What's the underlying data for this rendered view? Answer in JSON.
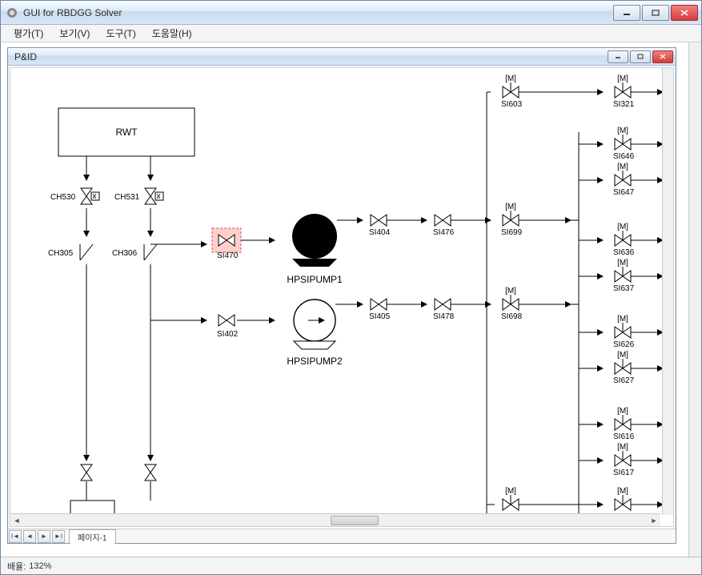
{
  "window": {
    "title": "GUI for RBDGG Solver"
  },
  "menu": {
    "evaluate": "평가(T)",
    "view": "보기(V)",
    "tools": "도구(T)",
    "help": "도움말(H)"
  },
  "inner": {
    "title": "P&ID"
  },
  "nav": {
    "page_tab": "페이지-1"
  },
  "status": {
    "zoom_label": "배율:",
    "zoom_value": "132%"
  },
  "diagram": {
    "blocks": {
      "rwt": "RWT",
      "pump1": "HPSIPUMP1",
      "pump2": "HPSIPUMP2"
    },
    "valves": {
      "ch530": "CH530",
      "ch531": "CH531",
      "ch305": "CH305",
      "ch306": "CH306",
      "si470": "SI470",
      "si402": "SI402",
      "si404": "SI404",
      "si476": "SI476",
      "si699": "SI699",
      "si405": "SI405",
      "si478": "SI478",
      "si698": "SI698",
      "si603": "SI603",
      "si321": "SI321",
      "si646": "SI646",
      "si647": "SI647",
      "si636": "SI636",
      "si637": "SI637",
      "si626": "SI626",
      "si627": "SI627",
      "si616": "SI616",
      "si617": "SI617"
    }
  }
}
